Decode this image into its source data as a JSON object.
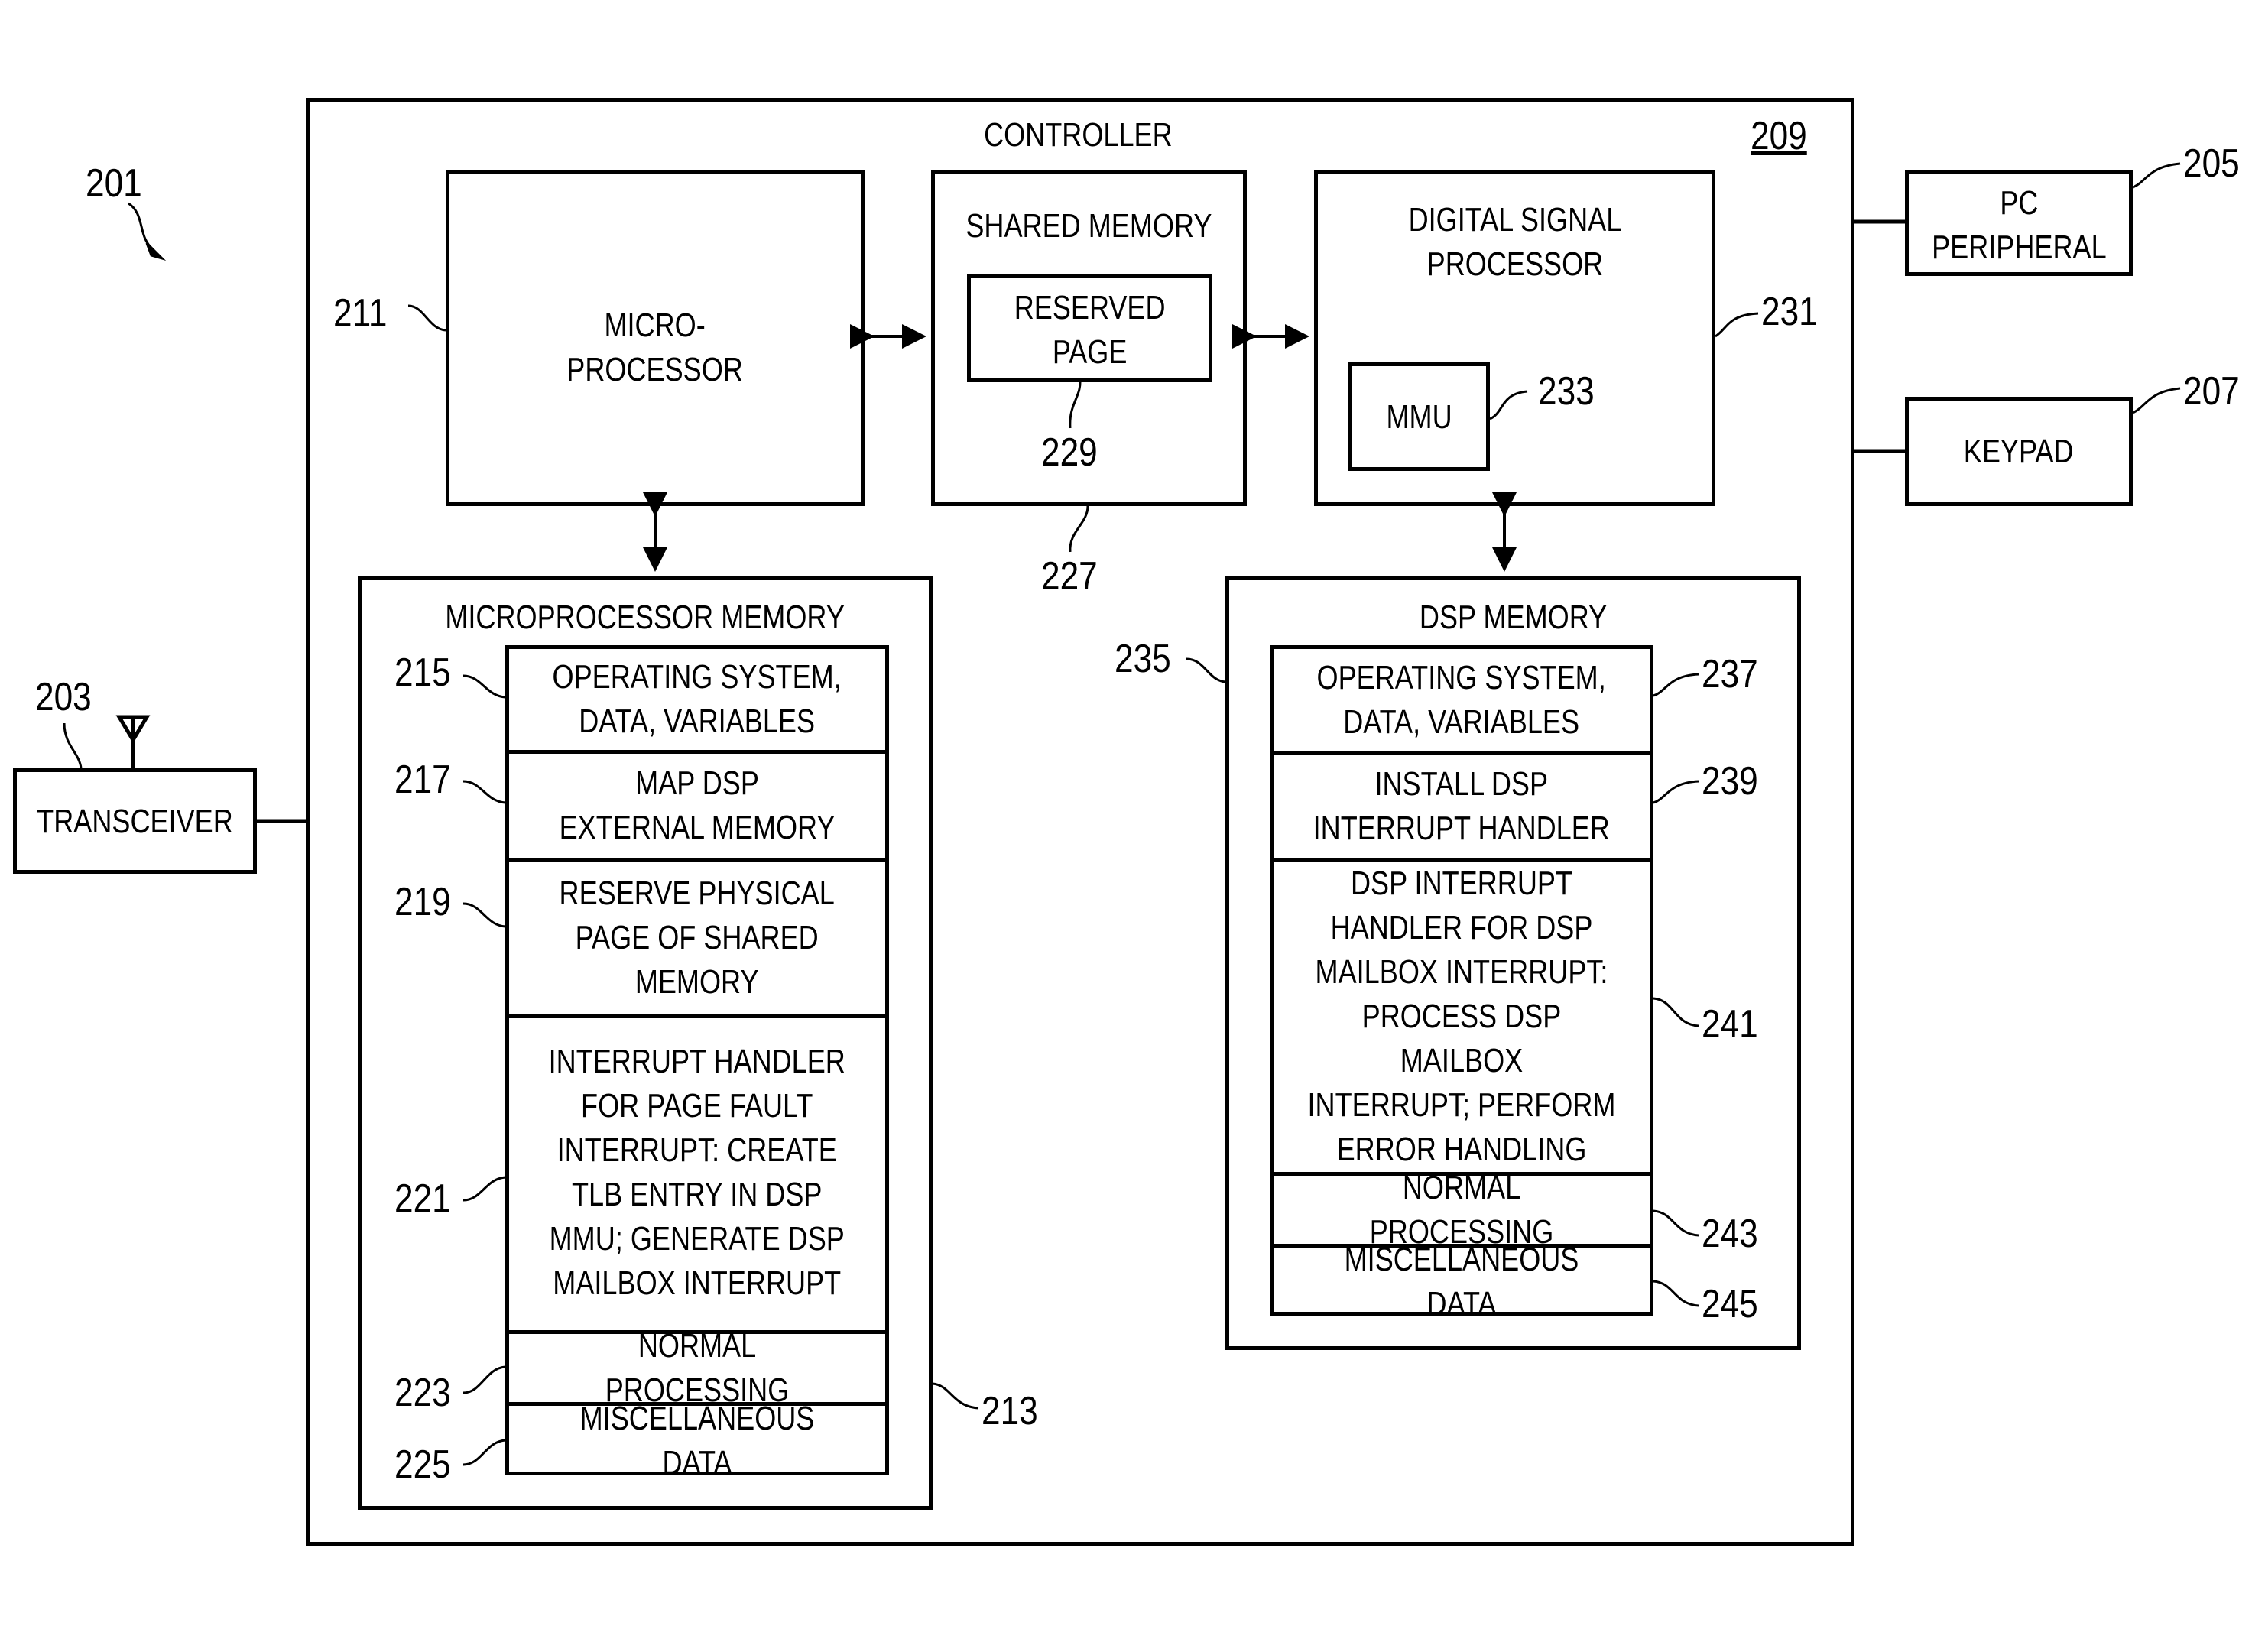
{
  "figure_ref": "201",
  "controller": {
    "title": "CONTROLLER",
    "ref": "209"
  },
  "microprocessor": {
    "label": "MICRO-\nPROCESSOR",
    "ref": "211"
  },
  "shared_memory": {
    "label": "SHARED MEMORY",
    "ref": "227",
    "reserved_page": {
      "label": "RESERVED\nPAGE",
      "ref": "229"
    }
  },
  "dsp": {
    "label": "DIGITAL SIGNAL\nPROCESSOR",
    "ref": "231",
    "mmu": {
      "label": "MMU",
      "ref": "233"
    }
  },
  "microprocessor_memory": {
    "title": "MICROPROCESSOR MEMORY",
    "ref": "213",
    "rows": [
      {
        "label": "OPERATING SYSTEM,\nDATA, VARIABLES",
        "ref": "215"
      },
      {
        "label": "MAP DSP\nEXTERNAL MEMORY",
        "ref": "217"
      },
      {
        "label": "RESERVE PHYSICAL\nPAGE OF SHARED\nMEMORY",
        "ref": "219"
      },
      {
        "label": "INTERRUPT HANDLER\nFOR PAGE FAULT\nINTERRUPT: CREATE\nTLB ENTRY IN DSP\nMMU; GENERATE DSP\nMAILBOX INTERRUPT",
        "ref": "221"
      },
      {
        "label": "NORMAL PROCESSING",
        "ref": "223"
      },
      {
        "label": "MISCELLANEOUS DATA",
        "ref": "225"
      }
    ]
  },
  "dsp_memory": {
    "title": "DSP MEMORY",
    "ref": "235",
    "rows": [
      {
        "label": "OPERATING SYSTEM,\nDATA, VARIABLES",
        "ref": "237"
      },
      {
        "label": "INSTALL DSP\nINTERRUPT HANDLER",
        "ref": "239"
      },
      {
        "label": "DSP INTERRUPT\nHANDLER FOR DSP\nMAILBOX INTERRUPT:\nPROCESS DSP MAILBOX\nINTERRUPT; PERFORM\nERROR HANDLING",
        "ref": "241"
      },
      {
        "label": "NORMAL PROCESSING",
        "ref": "243"
      },
      {
        "label": "MISCELLANEOUS DATA",
        "ref": "245"
      }
    ]
  },
  "pc_peripheral": {
    "label": "PC\nPERIPHERAL",
    "ref": "205"
  },
  "keypad": {
    "label": "KEYPAD",
    "ref": "207"
  },
  "transceiver": {
    "label": "TRANSCEIVER",
    "ref": "203"
  }
}
